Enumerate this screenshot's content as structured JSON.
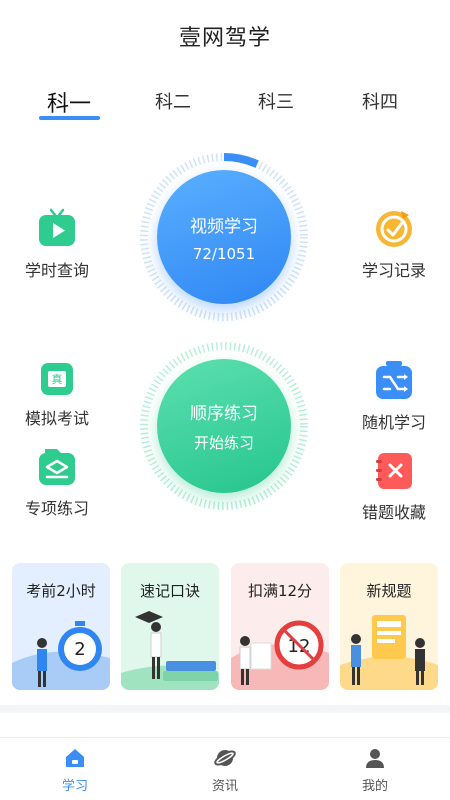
{
  "header": {
    "title": "壹网驾学"
  },
  "tabs": [
    {
      "label": "科一",
      "active": true
    },
    {
      "label": "科二",
      "active": false
    },
    {
      "label": "科三",
      "active": false
    },
    {
      "label": "科四",
      "active": false
    }
  ],
  "video_circle": {
    "title": "视频学习",
    "progress_text": "72/1051",
    "progress_fraction": 0.068
  },
  "practice_circle": {
    "title": "顺序练习",
    "subtitle": "开始练习"
  },
  "side_items": {
    "study_time": {
      "label": "学时查询",
      "icon": "play-tv-icon",
      "color": "#2ecc8f"
    },
    "study_record": {
      "label": "学习记录",
      "icon": "record-icon",
      "color": "#f7b733"
    },
    "mock_exam": {
      "label": "模拟考试",
      "icon": "exam-icon",
      "icon_text": "真",
      "color": "#2ecc8f"
    },
    "random_study": {
      "label": "随机学习",
      "icon": "shuffle-icon",
      "color": "#3a8ef6"
    },
    "topic_practice": {
      "label": "专项练习",
      "icon": "topic-icon",
      "color": "#2ecc8f"
    },
    "error_collection": {
      "label": "错题收藏",
      "icon": "error-book-icon",
      "color": "#ff5a5a"
    }
  },
  "cards": [
    {
      "title": "考前2小时",
      "bg": "#e3efff",
      "badge": "2"
    },
    {
      "title": "速记口诀",
      "bg": "#e0f7ec"
    },
    {
      "title": "扣满12分",
      "bg": "#fdecec",
      "badge": "12"
    },
    {
      "title": "新规题",
      "bg": "#fff4dc"
    }
  ],
  "bottom_nav": [
    {
      "label": "学习",
      "icon": "home-icon",
      "active": true
    },
    {
      "label": "资讯",
      "icon": "planet-icon",
      "active": false
    },
    {
      "label": "我的",
      "icon": "user-icon",
      "active": false
    }
  ],
  "colors": {
    "accent": "#3a8ef6",
    "green": "#26c58d"
  }
}
